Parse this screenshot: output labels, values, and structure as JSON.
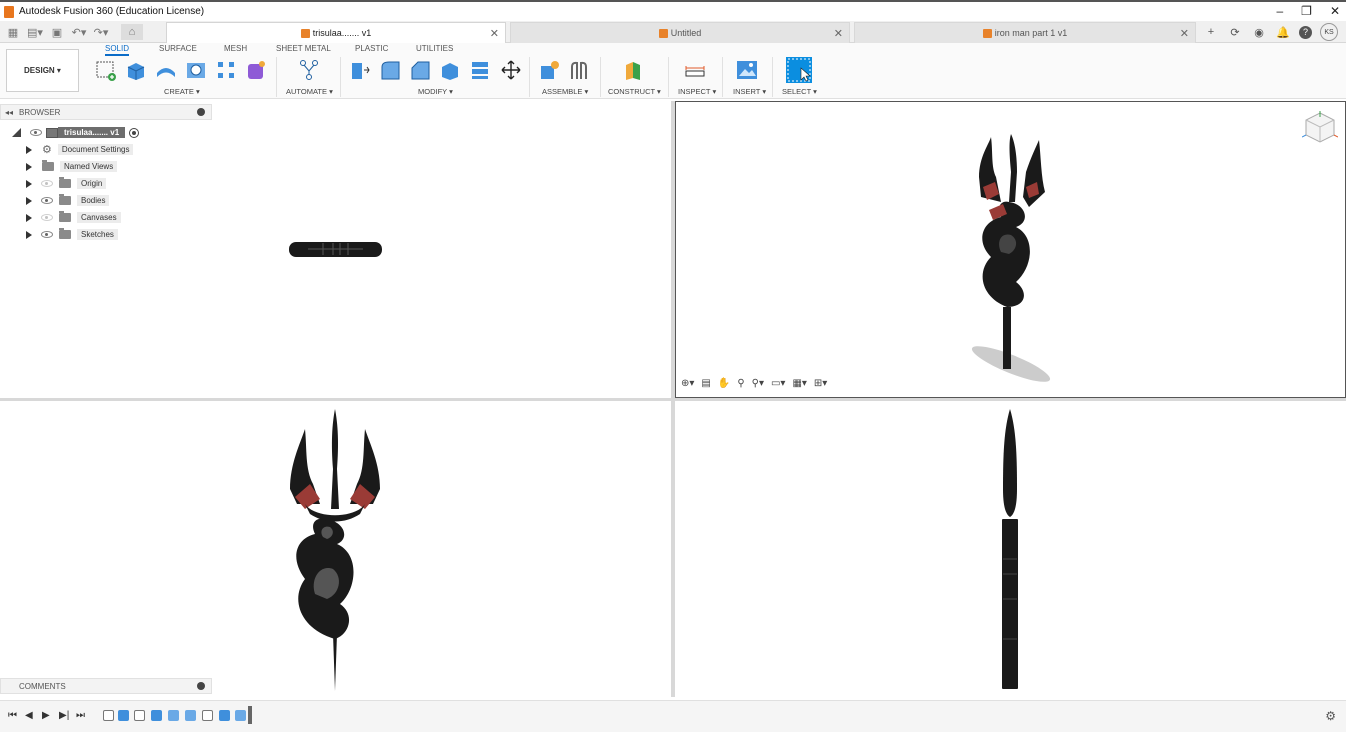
{
  "window": {
    "title": "Autodesk Fusion 360 (Education License)",
    "controls": [
      "–",
      "❐",
      "✕"
    ]
  },
  "tabs": [
    {
      "label": "trisulaa....... v1",
      "active": true
    },
    {
      "label": "Untitled",
      "active": false
    },
    {
      "label": "iron man part 1 v1",
      "active": false
    }
  ],
  "user": {
    "initials": "KS"
  },
  "ribbon": {
    "workspace": "DESIGN",
    "tabs": [
      "SOLID",
      "SURFACE",
      "MESH",
      "SHEET METAL",
      "PLASTIC",
      "UTILITIES"
    ],
    "groups": {
      "create": "CREATE",
      "automate": "AUTOMATE",
      "modify": "MODIFY",
      "assemble": "ASSEMBLE",
      "construct": "CONSTRUCT",
      "inspect": "INSPECT",
      "insert": "INSERT",
      "select": "SELECT"
    }
  },
  "browser": {
    "title": "BROWSER",
    "root": "trisulaa....... v1",
    "items": [
      {
        "label": "Document Settings",
        "icon": "gear-icon"
      },
      {
        "label": "Named Views",
        "icon": "folder-icon"
      },
      {
        "label": "Origin",
        "icon": "folder-icon",
        "eye": "hidden"
      },
      {
        "label": "Bodies",
        "icon": "folder-icon",
        "eye": "visible"
      },
      {
        "label": "Canvases",
        "icon": "folder-icon",
        "eye": "hidden"
      },
      {
        "label": "Sketches",
        "icon": "folder-icon",
        "eye": "visible"
      }
    ]
  },
  "comments": {
    "title": "COMMENTS"
  },
  "colors": {
    "accent": "#0b6cc8",
    "brand": "#e8761e",
    "model_dark": "#1a1a1a",
    "model_red": "#9a3b36"
  }
}
